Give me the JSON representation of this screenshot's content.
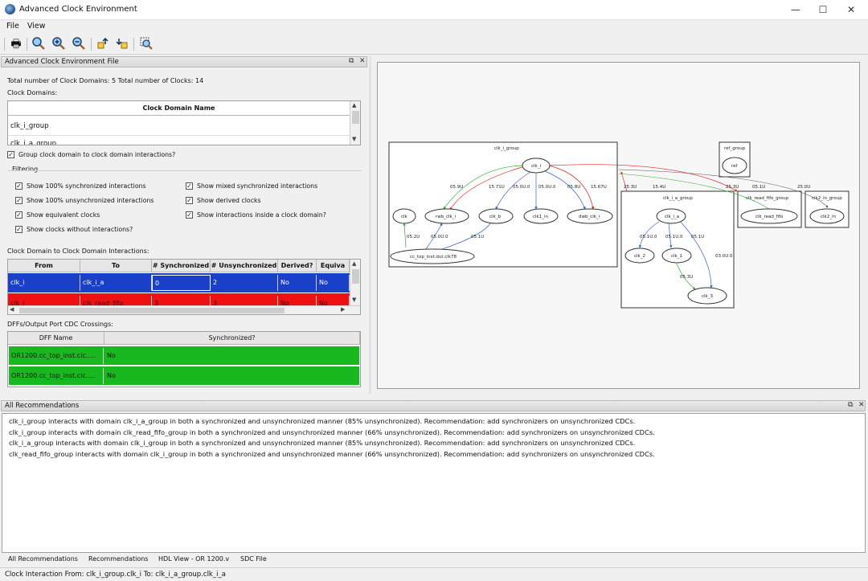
{
  "window": {
    "title": "Advanced Clock Environment",
    "controls": {
      "minimize": "—",
      "maximize": "☐",
      "close": "✕"
    }
  },
  "menu": {
    "file": "File",
    "view": "View"
  },
  "toolbar": {
    "icons": [
      "print-icon",
      "zoom-fit-icon",
      "zoom-in-icon",
      "zoom-out-icon",
      "hierarchy-up-icon",
      "hierarchy-down-icon",
      "zoom-select-icon"
    ]
  },
  "left_panel": {
    "title": "Advanced Clock Environment File",
    "summary": "Total number of Clock Domains: 5 Total number of Clocks: 14",
    "clock_domains_label": "Clock Domains:",
    "clock_domain_header": "Clock Domain Name",
    "clock_domains": [
      "clk_i_group",
      "clk_i_a_group"
    ],
    "group_checkbox": "Group clock domain to clock domain interactions?",
    "filtering_label": "Filtering",
    "filters_left": [
      "Show 100% synchronized interactions",
      "Show 100% unsynchronized interactions",
      "Show equivalent clocks",
      "Show clocks without interactions?"
    ],
    "filters_right": [
      "Show mixed synchronized interactions",
      "Show derived clocks",
      "Show interactions inside a clock domain?"
    ],
    "interactions_label": "Clock Domain to Clock Domain Interactions:",
    "interactions_headers": [
      "From",
      "To",
      "# Synchronized",
      "# Unsynchronized",
      "Derived?",
      "Equiva"
    ],
    "interactions_rows": [
      {
        "from": "clk_i",
        "to": "clk_i_a",
        "sync": "0",
        "unsync": "2",
        "derived": "No",
        "equiv": "No",
        "color": "#1a3fc8"
      },
      {
        "from": "clk_i",
        "to": "clk_read_fifo",
        "sync": "3",
        "unsync": "3",
        "derived": "No",
        "equiv": "No",
        "color": "#ee1111"
      }
    ],
    "dff_label": "DFFs/Output Port CDC Crossings:",
    "dff_headers": [
      "DFF Name",
      "Synchronized?"
    ],
    "dff_rows": [
      {
        "name": "OR1200.cc_top_inst.cic.....",
        "sync": "No"
      },
      {
        "name": "OR1200.cc_top_inst.cic.....",
        "sync": "No"
      }
    ]
  },
  "graph": {
    "clusters": [
      "clk_i_group",
      "clk_i_a_group",
      "clk_read_fifo_group",
      "clk2_in_group",
      "ref_group"
    ],
    "nodes": [
      "clk_i",
      "clk",
      "rwb_clk_i",
      "clk_b",
      "clk1_in",
      "dwb_clk_i",
      "cc_top_inst.dut.clk78",
      "clk_i_a",
      "clk_2",
      "clk_1",
      "clk_3",
      "clk_read_fifo",
      "clk2_in",
      "ref"
    ],
    "edge_labels": [
      "05.9U",
      "15.71U",
      "05.0U.0",
      "05.0U.0",
      "05.8U",
      "15.67U",
      "05.2U",
      "05.0U.0",
      "05.1U",
      "25.3U",
      "15.4U",
      "25.3U",
      "05.1U",
      "25.0U",
      "05.1U.0",
      "05.1U.0",
      "05.1U",
      "05.3U",
      "03.0U.0"
    ]
  },
  "recommendations": {
    "title": "All Recommendations",
    "lines": [
      "clk_i_group interacts with domain clk_i_a_group in both a synchronized and unsynchronized manner (85% unsynchronized). Recommendation: add synchronizers on unsynchronized CDCs.",
      "clk_i_group interacts with domain clk_read_fifo_group in both a synchronized and unsynchronized manner (66% unsynchronized). Recommendation: add synchronizers on unsynchronized CDCs.",
      "clk_i_a_group interacts with domain clk_i_group in both a synchronized and unsynchronized manner (85% unsynchronized). Recommendation: add synchronizers on unsynchronized CDCs.",
      "clk_read_fifo_group interacts with domain clk_i_group in both a synchronized and unsynchronized manner (66% unsynchronized). Recommendation: add synchronizers on unsynchronized CDCs."
    ]
  },
  "bottom_tabs": [
    "All Recommendations",
    "Recommendations",
    "HDL View - OR 1200.v",
    "SDC File"
  ],
  "status": "Clock Interaction From: clk_i_group.clk_i To: clk_i_a_group.clk_i_a",
  "colors": {
    "sync_blue": "#1a3fc8",
    "unsync_red": "#ee1111",
    "dff_green": "#19b81e"
  }
}
